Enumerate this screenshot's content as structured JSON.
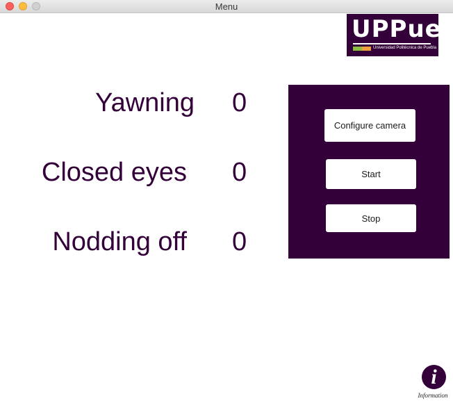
{
  "window": {
    "title": "Menu"
  },
  "logo": {
    "brand": "UPPue",
    "subtitle": "Universidad Politécnica de Puebla"
  },
  "counters": [
    {
      "label": "Yawning",
      "value": "0"
    },
    {
      "label": "Closed eyes",
      "value": "0"
    },
    {
      "label": "Nodding off",
      "value": "0"
    }
  ],
  "controls": {
    "configure_label": "Configure camera",
    "start_label": "Start",
    "stop_label": "Stop"
  },
  "info": {
    "glyph": "i",
    "caption": "Information"
  },
  "colors": {
    "primary": "#33003a",
    "background": "#ffffff",
    "button": "#ffffff"
  }
}
